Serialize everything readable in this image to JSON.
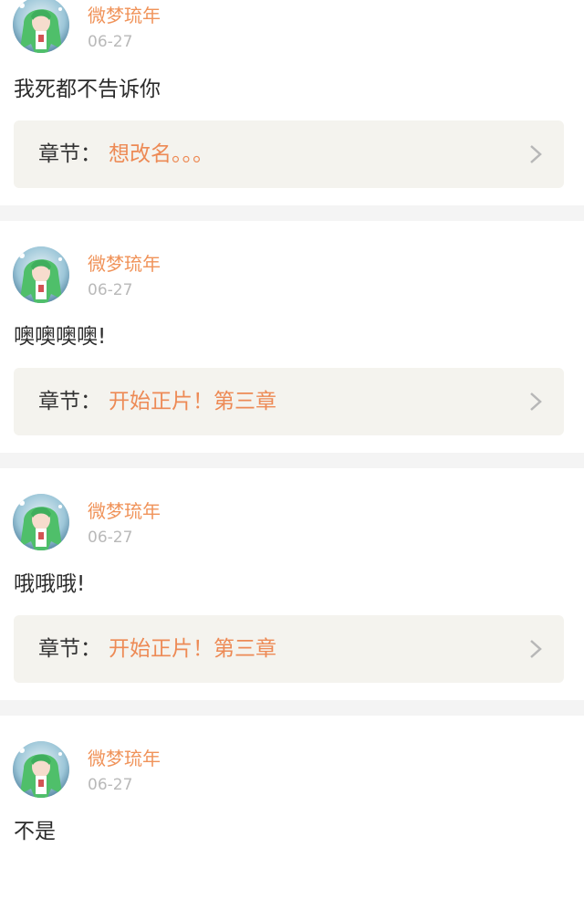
{
  "feed": {
    "items": [
      {
        "username": "微梦琉年",
        "date": "06-27",
        "comment": "我死都不告诉你",
        "chapter_prefix": "章节：",
        "chapter_title": "想改名。。。"
      },
      {
        "username": "微梦琉年",
        "date": "06-27",
        "comment": "噢噢噢噢!",
        "chapter_prefix": "章节：",
        "chapter_title": "开始正片！第三章"
      },
      {
        "username": "微梦琉年",
        "date": "06-27",
        "comment": "哦哦哦!",
        "chapter_prefix": "章节：",
        "chapter_title": "开始正片！第三章"
      },
      {
        "username": "微梦琉年",
        "date": "06-27",
        "comment": "不是"
      }
    ]
  },
  "theme": {
    "username_color": "#f0935a",
    "chapter_title_color": "#ed8a55",
    "date_color": "#b9b9b9",
    "chapter_box_bg": "#f4f3ee",
    "separator_bg": "#f4f4f4"
  },
  "icons": {
    "avatar": "anime-girl-avatar",
    "chevron": "chevron-right-icon"
  }
}
